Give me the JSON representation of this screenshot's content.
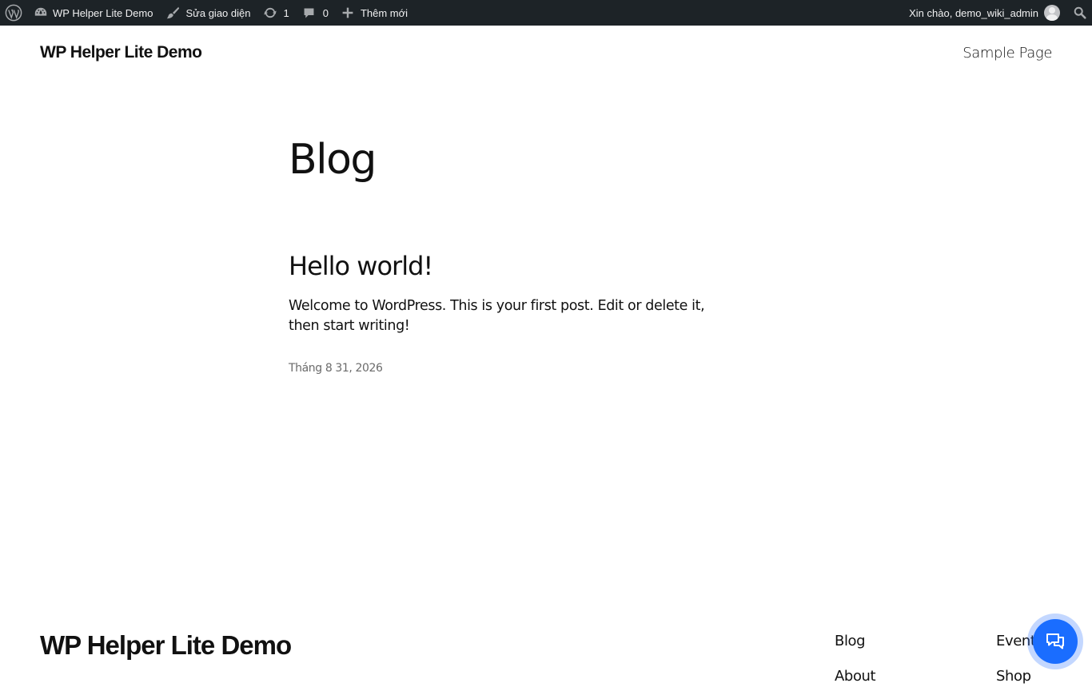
{
  "adminbar": {
    "site_name": "WP Helper Lite Demo",
    "customize": "Sửa giao diện",
    "updates_count": "1",
    "comments_count": "0",
    "new_label": "Thêm mới",
    "greeting": "Xin chào, demo_wiki_admin"
  },
  "header": {
    "site_title": "WP Helper Lite Demo",
    "nav": [
      "Sample Page"
    ]
  },
  "main": {
    "page_title": "Blog",
    "posts": [
      {
        "title": "Hello world!",
        "excerpt": "Welcome to WordPress. This is your first post. Edit or delete it, then start writing!",
        "date": "Tháng 8 31, 2026"
      }
    ]
  },
  "footer": {
    "site_title": "WP Helper Lite Demo",
    "links": [
      "Blog",
      "About",
      "Events",
      "Shop"
    ]
  },
  "colors": {
    "adminbar_bg": "#1d2327",
    "chat_button": "#1a6dff",
    "text": "#111111",
    "muted": "#6b6b6b"
  },
  "icons": {
    "wp": "wordpress-logo-icon",
    "dashboard": "dashboard-icon",
    "customize": "brush-icon",
    "updates": "updates-icon",
    "comments": "comment-icon",
    "new": "plus-icon",
    "search": "search-icon",
    "chat": "chat-icon"
  }
}
